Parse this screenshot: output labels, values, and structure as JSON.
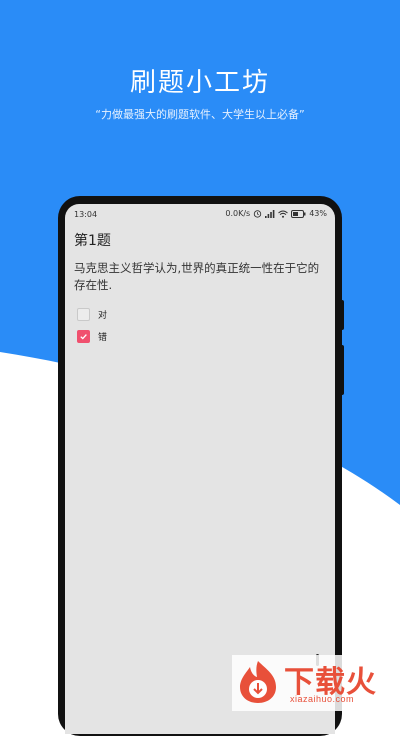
{
  "banner": {
    "title": "刷题小工坊",
    "slogan": "“力做最强大的刷题软件、大学生以上必备”"
  },
  "status_bar": {
    "time": "13:04",
    "network_speed": "0.0K/s",
    "battery": "43%",
    "icons": [
      "alarm-icon",
      "signal-icon",
      "wifi-icon",
      "battery-icon"
    ]
  },
  "question": {
    "title": "第1题",
    "text": "马克思主义哲学认为,世界的真正统一性在于它的存在性.",
    "options": [
      {
        "label": "对",
        "checked": false
      },
      {
        "label": "错",
        "checked": true
      }
    ]
  },
  "watermark": {
    "brand": "下载火",
    "url": "xiazaihuo.com"
  },
  "colors": {
    "brand_blue": "#2a8cf7",
    "check_red": "#f0506e",
    "watermark_red": "#e8503a"
  }
}
